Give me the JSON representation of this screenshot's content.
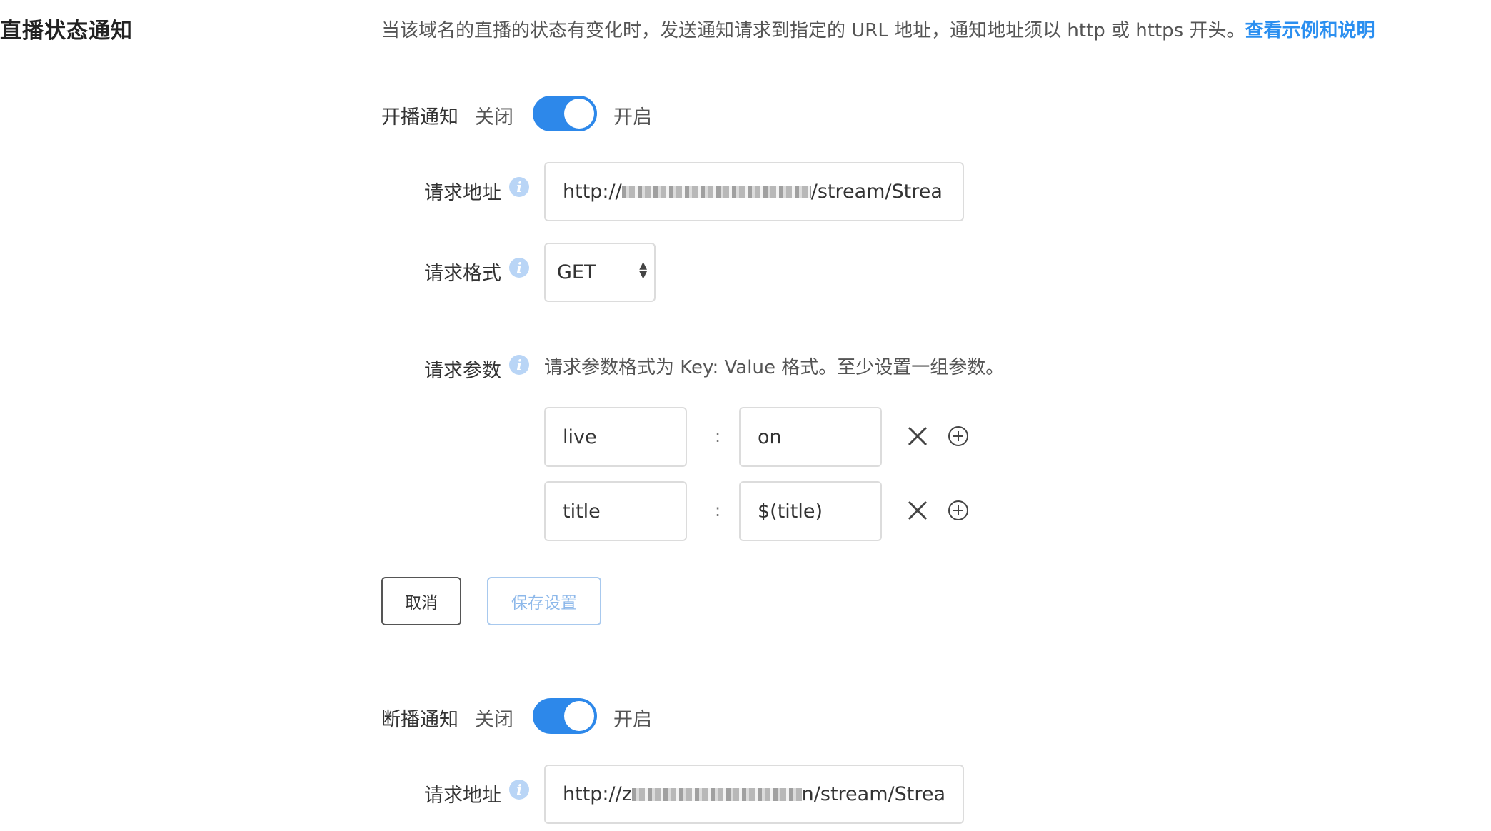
{
  "section": {
    "title": "直播状态通知",
    "description": "当该域名的直播的状态有变化时，发送通知请求到指定的 URL 地址，通知地址须以 http 或 https 开头。",
    "help_link": "查看示例和说明"
  },
  "start_notify": {
    "label": "开播通知",
    "off_label": "关闭",
    "on_label": "开启",
    "enabled": true,
    "url_label": "请求地址",
    "url_prefix": "http://",
    "url_suffix": "/stream/Strea",
    "format_label": "请求格式",
    "format_value": "GET",
    "params_label": "请求参数",
    "params_hint": "请求参数格式为 Key: Value 格式。至少设置一组参数。",
    "params": [
      {
        "key": "live",
        "value": "on"
      },
      {
        "key": "title",
        "value": "$(title)"
      }
    ],
    "colon": ":",
    "cancel_label": "取消",
    "save_label": "保存设置"
  },
  "stop_notify": {
    "label": "断播通知",
    "off_label": "关闭",
    "on_label": "开启",
    "enabled": true,
    "url_label": "请求地址",
    "url_prefix": "http://z",
    "url_suffix": "n/stream/Strea"
  },
  "colors": {
    "accent": "#2d88ea",
    "link": "#2b8ff0",
    "info_icon": "#b9d5f6"
  },
  "icons": [
    "info-icon",
    "close-icon",
    "plus-circle-icon",
    "select-arrows-icon"
  ]
}
